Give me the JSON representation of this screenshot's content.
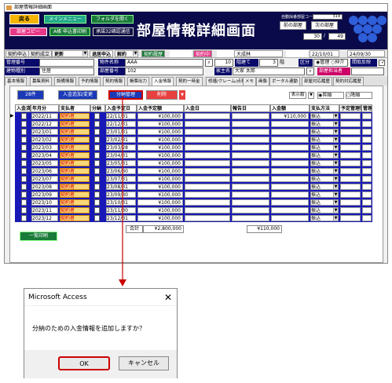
{
  "window": {
    "title": "部屋情報詳細画面"
  },
  "header": {
    "back_label": "戻る",
    "main_menu_label": "メインメニュー",
    "folder_label": "フォルダを開く",
    "copy_label": "部屋コピー",
    "print_label": "A帳 申込書印刷",
    "print2_label": "承諾32確認通信",
    "title": "部屋情報詳細画面",
    "prev_room": "前の部屋",
    "next_room": "次の部屋",
    "auto_code_label": "自動採番部屋コード",
    "auto_code_value": "319",
    "page_current": "30",
    "page_total": "49",
    "contract_apply": "契約申込",
    "contract_done": "契約成立",
    "update": "更新",
    "cancel_status": "退居申込",
    "cancellation": "解約",
    "contract_history": "契約履歴",
    "contract_status_label": "契約状況",
    "contract_status_value": "契約中",
    "contractor_label": "契約者",
    "contractor_value": "大成林",
    "period_label": "契約期間",
    "period_from": "22/10/01",
    "period_to": "24/09/30"
  },
  "property": {
    "mgmt_no_label": "管理番号",
    "building_label": "物件名称",
    "building_value": "AAA",
    "search_btn": "10",
    "floor_label": "階建て",
    "floor_value": "3",
    "floor_unit": "階",
    "type_label": "区分",
    "type_opt1": "管理",
    "type_opt2": "仲介",
    "layout_label": "間取反映",
    "kind_label": "建物種別",
    "kind_value": "住居",
    "room_label": "部屋番号",
    "room_value": "102",
    "owner_label": "家主名",
    "owner_value": "大家 太郎",
    "room_staff_label": "部屋担当者"
  },
  "tabs": [
    "基本情報",
    "募集資料",
    "設備情報",
    "予約情報",
    "契約情報",
    "帳票出力",
    "入金情報",
    "契約一時金",
    "修繕/クレーム/点検",
    "メモ",
    "画像",
    "ボータル連動",
    "部屋対応履歴",
    "契約対応履歴"
  ],
  "panel": {
    "count": "28件",
    "add_change": "入金追加/変更",
    "split_manage": "分納管理",
    "delete": "削除",
    "display_order": "表示順",
    "asc": "昇順",
    "desc": "降順",
    "print_all": "一覧印刷",
    "total_label": "合計",
    "total_plan": "¥2,800,000",
    "total_amount": "¥110,000"
  },
  "columns": [
    "入金済",
    "年月分",
    "支払者",
    "分納",
    "入金予定日",
    "入金予定額",
    "入金日",
    "報告日",
    "入金額",
    "支払方法",
    "予定管理料",
    "管理料"
  ],
  "rows": [
    {
      "ym": "2022/11",
      "payer": "契約者",
      "plan_date": "22/11/31",
      "plan_amount": "¥100,000",
      "amount": "¥110,000",
      "method": "振込"
    },
    {
      "ym": "2022/12",
      "payer": "契約者",
      "plan_date": "22/12/31",
      "plan_amount": "¥100,000",
      "amount": "",
      "method": "振込"
    },
    {
      "ym": "2023/01",
      "payer": "契約者",
      "plan_date": "23/01/31",
      "plan_amount": "¥100,000",
      "amount": "",
      "method": "振込"
    },
    {
      "ym": "2023/02",
      "payer": "契約者",
      "plan_date": "23/02/31",
      "plan_amount": "¥100,000",
      "amount": "",
      "method": "振込"
    },
    {
      "ym": "2023/03",
      "payer": "契約者",
      "plan_date": "23/03/28",
      "plan_amount": "¥100,000",
      "amount": "",
      "method": "振込"
    },
    {
      "ym": "2023/04",
      "payer": "契約者",
      "plan_date": "23/04/31",
      "plan_amount": "¥100,000",
      "amount": "",
      "method": "振込"
    },
    {
      "ym": "2023/05",
      "payer": "契約者",
      "plan_date": "23/05/31",
      "plan_amount": "¥100,000",
      "amount": "",
      "method": "振込"
    },
    {
      "ym": "2023/06",
      "payer": "契約者",
      "plan_date": "23/06/30",
      "plan_amount": "¥100,000",
      "amount": "",
      "method": "振込"
    },
    {
      "ym": "2023/07",
      "payer": "契約者",
      "plan_date": "23/07/31",
      "plan_amount": "¥100,000",
      "amount": "",
      "method": "振込"
    },
    {
      "ym": "2023/08",
      "payer": "契約者",
      "plan_date": "23/08/31",
      "plan_amount": "¥100,000",
      "amount": "",
      "method": "振込"
    },
    {
      "ym": "2023/09",
      "payer": "契約者",
      "plan_date": "23/09/30",
      "plan_amount": "¥100,000",
      "amount": "",
      "method": "振込"
    },
    {
      "ym": "2023/10",
      "payer": "契約者",
      "plan_date": "23/10/31",
      "plan_amount": "¥100,000",
      "amount": "",
      "method": "振込"
    },
    {
      "ym": "2023/11",
      "payer": "契約者",
      "plan_date": "23/11/30",
      "plan_amount": "¥100,000",
      "amount": "",
      "method": "振込"
    },
    {
      "ym": "2023/12",
      "payer": "契約者",
      "plan_date": "23/12/31",
      "plan_amount": "¥100,000",
      "amount": "",
      "method": "振込"
    }
  ],
  "dialog": {
    "title": "Microsoft Access",
    "close": "✕",
    "message": "分納のための入金情報を追加しますか？",
    "ok": "OK",
    "cancel": "キャンセル"
  },
  "colors": {
    "header_bg": "#0a0a4a",
    "grid_row": "#1818b8",
    "highlight": "#cc0000"
  }
}
